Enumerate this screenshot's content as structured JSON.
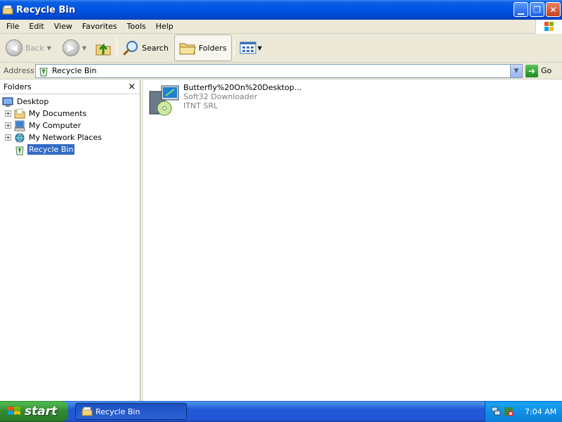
{
  "window": {
    "title": "Recycle Bin"
  },
  "menu": [
    "File",
    "Edit",
    "View",
    "Favorites",
    "Tools",
    "Help"
  ],
  "toolbar": {
    "back_label": "Back",
    "search_label": "Search",
    "folders_label": "Folders"
  },
  "address": {
    "label": "Address",
    "value": "Recycle Bin",
    "go_label": "Go"
  },
  "folders_pane": {
    "header": "Folders",
    "close": "×",
    "tree": [
      {
        "label": "Desktop",
        "icon": "desktop-icon"
      },
      {
        "label": "My Documents",
        "icon": "my-documents-icon",
        "expander": "+"
      },
      {
        "label": "My Computer",
        "icon": "my-computer-icon",
        "expander": "+"
      },
      {
        "label": "My Network Places",
        "icon": "network-places-icon",
        "expander": "+"
      },
      {
        "label": "Recycle Bin",
        "icon": "recycle-bin-icon",
        "selected": true
      }
    ]
  },
  "content": {
    "item": {
      "name": "Butterfly%20On%20Desktop...",
      "line2": "Soft32 Downloader",
      "line3": "ITNT SRL",
      "icon": "installer-icon"
    }
  },
  "taskbar": {
    "start_label": "start",
    "task_label": "Recycle Bin",
    "clock": "7:04 AM"
  },
  "colors": {
    "titlebar": "#0054e3",
    "taskbar": "#2157d7",
    "start": "#2f8a2f",
    "selection": "#316ac5"
  }
}
